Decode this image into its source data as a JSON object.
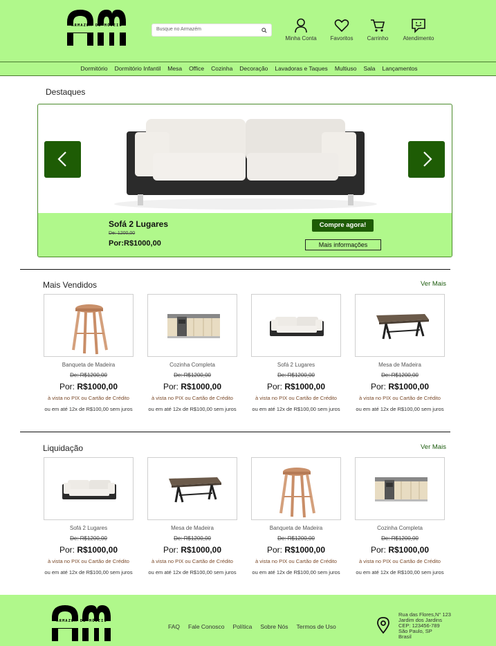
{
  "header": {
    "logo_text": "ARMAZÉM DE MÓVEIS",
    "search_placeholder": "Busque no Armazém",
    "icons": [
      {
        "name": "user-icon",
        "label": "Minha Conta"
      },
      {
        "name": "heart-icon",
        "label": "Favoritos"
      },
      {
        "name": "cart-icon",
        "label": "Carrinho"
      },
      {
        "name": "chat-icon",
        "label": "Atendimento"
      }
    ]
  },
  "nav": [
    "Dormitório",
    "Dormitório Infantil",
    "Mesa",
    "Office",
    "Cozinha",
    "Decoração",
    "Lavadoras e Taques",
    "Multiuso",
    "Sala",
    "Lançamentos"
  ],
  "highlights": {
    "title": "Destaques",
    "product": "Sofá 2 Lugares",
    "old_price": "De: 1200,00",
    "new_price_prefix": "Por:",
    "new_price": "R$1000,00",
    "buy_label": "Compre agora!",
    "more_label": "Mais informações"
  },
  "best_sellers": {
    "title": "Mais Vendidos",
    "see_more": "Ver Mais",
    "items": [
      {
        "name": "Banqueta de Madeira",
        "img": "stool",
        "old": "De: R$1200,00",
        "prefix": "Por:",
        "price": "R$1000,00",
        "pix": "à vista no PIX ou Cartão de Crédito",
        "inst": "ou em até 12x de R$100,00 sem juros"
      },
      {
        "name": "Cozinha Completa",
        "img": "kitchen",
        "old": "De: R$1200,00",
        "prefix": "Por:",
        "price": "R$1000,00",
        "pix": "à vista no PIX ou Cartão de Crédito",
        "inst": "ou em até 12x de R$100,00 sem juros"
      },
      {
        "name": "Sofá 2 Lugares",
        "img": "sofa",
        "old": "De: R$1200,00",
        "prefix": "Por:",
        "price": "R$1000,00",
        "pix": "à vista no PIX ou Cartão de Crédito",
        "inst": "ou em até 12x de R$100,00 sem juros"
      },
      {
        "name": "Mesa de Madeira",
        "img": "table",
        "old": "De: R$1200,00",
        "prefix": "Por:",
        "price": "R$1000,00",
        "pix": "à vista no PIX ou Cartão de Crédito",
        "inst": "ou em até 12x de R$100,00 sem juros"
      }
    ]
  },
  "sale": {
    "title": "Liquidação",
    "see_more": "Ver Mais",
    "items": [
      {
        "name": "Sofá 2 Lugares",
        "img": "sofa",
        "old": "De: R$1200,00",
        "prefix": "Por:",
        "price": "R$1000,00",
        "pix": "à vista no PIX ou Cartão de Crédito",
        "inst": "ou em até 12x de R$100,00 sem juros"
      },
      {
        "name": "Mesa de Madeira",
        "img": "table",
        "old": "De: R$1200,00",
        "prefix": "Por:",
        "price": "R$1000,00",
        "pix": "à vista no PIX ou Cartão de Crédito",
        "inst": "ou em até 12x de R$100,00 sem juros"
      },
      {
        "name": "Banqueta de Madeira",
        "img": "stool",
        "old": "De: R$1200,00",
        "prefix": "Por:",
        "price": "R$1000,00",
        "pix": "à vista no PIX ou Cartão de Crédito",
        "inst": "ou em até 12x de R$100,00 sem juros"
      },
      {
        "name": "Cozinha Completa",
        "img": "kitchen",
        "old": "De: R$1200,00",
        "prefix": "Por:",
        "price": "R$1000,00",
        "pix": "à vista no PIX ou Cartão de Crédito",
        "inst": "ou em até 12x de R$100,00 sem juros"
      }
    ]
  },
  "footer": {
    "links": [
      "FAQ",
      "Fale Conosco",
      "Política",
      "Sobre Nós",
      "Termos de Uso"
    ],
    "address": [
      "Rua das Flores,N° 123",
      "Jardim dos Jardins",
      "CEP: 123456-789",
      "São Paulo, SP",
      "Brasil"
    ]
  },
  "colors": {
    "brand_green": "#b0f88b",
    "dark_green": "#1e5c05"
  }
}
